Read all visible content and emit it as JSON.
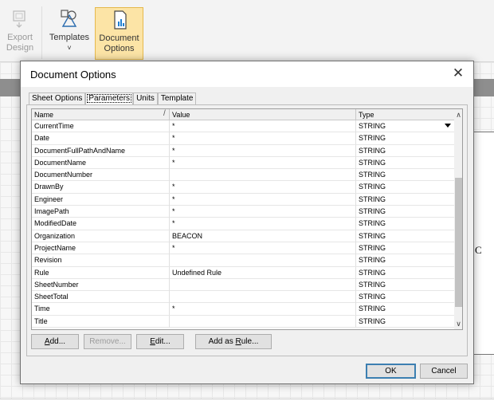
{
  "ribbon": {
    "buttons": [
      {
        "label_line1": "Export",
        "label_line2": "Design",
        "icon": "export-design-icon"
      },
      {
        "label_line1": "Templates",
        "label_line2": "˅",
        "icon": "templates-icon"
      },
      {
        "label_line1": "Document",
        "label_line2": "Options",
        "icon": "document-options-icon"
      }
    ]
  },
  "canvas": {
    "side_letter": "C"
  },
  "dialog": {
    "title": "Document Options",
    "close_label": "✕",
    "tabs": [
      "Sheet Options",
      "Parameters",
      "Units",
      "Template"
    ],
    "active_tab": "Parameters",
    "grid": {
      "columns": [
        "Name",
        "Value",
        "Type"
      ],
      "sort_indicator": "/",
      "rows": [
        {
          "name": "CurrentTime",
          "value": "*",
          "type": "STRING"
        },
        {
          "name": "Date",
          "value": "*",
          "type": "STRING"
        },
        {
          "name": "DocumentFullPathAndName",
          "value": "*",
          "type": "STRING"
        },
        {
          "name": "DocumentName",
          "value": "*",
          "type": "STRING"
        },
        {
          "name": "DocumentNumber",
          "value": "",
          "type": "STRING"
        },
        {
          "name": "DrawnBy",
          "value": "*",
          "type": "STRING"
        },
        {
          "name": "Engineer",
          "value": "*",
          "type": "STRING"
        },
        {
          "name": "ImagePath",
          "value": "*",
          "type": "STRING"
        },
        {
          "name": "ModifiedDate",
          "value": "*",
          "type": "STRING"
        },
        {
          "name": "Organization",
          "value": "BEACON",
          "type": "STRING"
        },
        {
          "name": "ProjectName",
          "value": "*",
          "type": "STRING"
        },
        {
          "name": "Revision",
          "value": "",
          "type": "STRING"
        },
        {
          "name": "Rule",
          "value": "Undefined Rule",
          "type": "STRING"
        },
        {
          "name": "SheetNumber",
          "value": "",
          "type": "STRING"
        },
        {
          "name": "SheetTotal",
          "value": "",
          "type": "STRING"
        },
        {
          "name": "Time",
          "value": "*",
          "type": "STRING"
        },
        {
          "name": "Title",
          "value": "",
          "type": "STRING"
        }
      ]
    },
    "panel_buttons": {
      "add": {
        "pre": "",
        "key": "A",
        "post": "dd..."
      },
      "remove": {
        "pre": "",
        "key": "",
        "post": "Remove..."
      },
      "edit": {
        "pre": "",
        "key": "E",
        "post": "dit..."
      },
      "add_as_rule": {
        "pre": "Add as ",
        "key": "R",
        "post": "ule..."
      }
    },
    "ok_label": "OK",
    "cancel_label": "Cancel"
  }
}
